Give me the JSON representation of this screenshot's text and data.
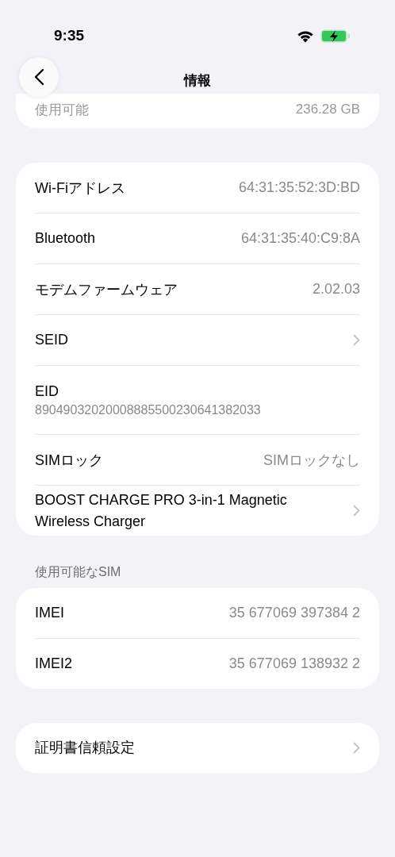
{
  "status_bar": {
    "time": "9:35"
  },
  "nav": {
    "title": "情報"
  },
  "storage_rows": [
    {
      "label": "使用可能",
      "value": "236.28 GB"
    }
  ],
  "groups": [
    {
      "rows": [
        {
          "kind": "value",
          "label": "Wi-Fiアドレス",
          "value": "64:31:35:52:3D:BD"
        },
        {
          "kind": "value",
          "label": "Bluetooth",
          "value": "64:31:35:40:C9:8A"
        },
        {
          "kind": "value",
          "label": "モデムファームウェア",
          "value": "2.02.03"
        },
        {
          "kind": "link",
          "label": "SEID"
        },
        {
          "kind": "stacked",
          "label": "EID",
          "value": "89049032020008885500230641382033"
        },
        {
          "kind": "value",
          "label": "SIMロック",
          "value": "SIMロックなし"
        },
        {
          "kind": "link",
          "label": "BOOST CHARGE PRO 3-in-1 Magnetic Wireless Charger"
        }
      ]
    },
    {
      "header": "使用可能なSIM",
      "rows": [
        {
          "kind": "value",
          "label": "IMEI",
          "value": "35 677069 397384 2"
        },
        {
          "kind": "value",
          "label": "IMEI2",
          "value": "35 677069 138932 2"
        }
      ]
    },
    {
      "rows": [
        {
          "kind": "link",
          "label": "証明書信頼設定"
        }
      ]
    }
  ]
}
